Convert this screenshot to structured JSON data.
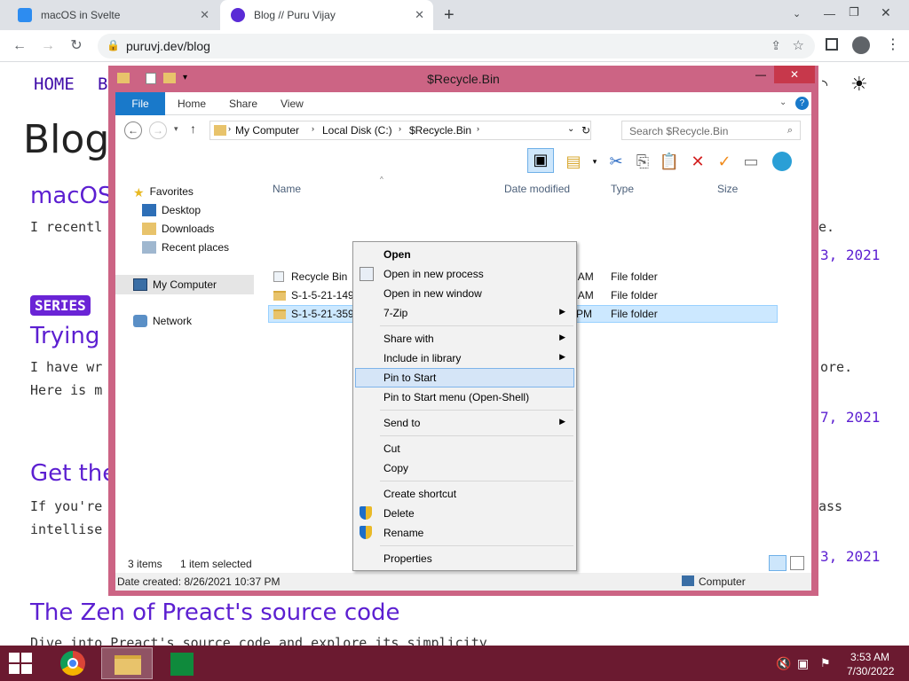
{
  "browser": {
    "tabs": [
      {
        "label": "macOS in Svelte"
      },
      {
        "label": "Blog // Puru Vijay"
      }
    ],
    "new_tab": "+",
    "url": "puruvj.dev/blog"
  },
  "blog": {
    "nav": {
      "home": "HOME",
      "blog": "B"
    },
    "title": "Blog",
    "posts": [
      {
        "title": "macOS",
        "excerpt": "I recentl",
        "excerpt_end": "e.",
        "date": "3, 2021"
      },
      {
        "series": "SERIES",
        "title": "Trying",
        "excerpt1": "I have wr",
        "excerpt1_end": "ore.",
        "excerpt2": "Here is m",
        "date": "7, 2021"
      },
      {
        "title": "Get the",
        "excerpt1": "If you're",
        "excerpt1_end": "ass",
        "excerpt2": "intellise",
        "date": "3, 2021"
      },
      {
        "title": "The Zen of Preact's source code",
        "excerpt": "Dive into Preact's source code and explore its simplicity"
      }
    ]
  },
  "explorer": {
    "title": "$Recycle.Bin",
    "ribbon_tabs": [
      "File",
      "Home",
      "Share",
      "View"
    ],
    "path": [
      "My Computer",
      "Local Disk (C:)",
      "$Recycle.Bin"
    ],
    "search_placeholder": "Search $Recycle.Bin",
    "nav": {
      "favorites": "Favorites",
      "desktop": "Desktop",
      "downloads": "Downloads",
      "recent": "Recent places",
      "computer": "My Computer",
      "network": "Network"
    },
    "columns": {
      "name": "Name",
      "date": "Date modified",
      "type": "Type",
      "size": "Size"
    },
    "rows": [
      {
        "name": "Recycle Bin",
        "date": "7/30/2022 2:50 AM",
        "type": "File folder"
      },
      {
        "name": "S-1-5-21-1491751080-2360097156-170421...",
        "date": "8/26/2021 9:05 AM",
        "type": "File folder"
      },
      {
        "name": "S-1-5-21-359",
        "date": "PM",
        "type": "File folder"
      }
    ],
    "status": {
      "items": "3 items",
      "selected": "1 item selected"
    },
    "details": {
      "created": "Date created: 8/26/2021 10:37 PM",
      "location": "Computer"
    }
  },
  "context_menu": {
    "items": [
      {
        "label": "Open"
      },
      {
        "label": "Open in new process"
      },
      {
        "label": "Open in new window"
      },
      {
        "label": "7-Zip"
      },
      {
        "label": "Share with"
      },
      {
        "label": "Include in library"
      },
      {
        "label": "Pin to Start"
      },
      {
        "label": "Pin to Start menu (Open-Shell)"
      },
      {
        "label": "Send to"
      },
      {
        "label": "Cut"
      },
      {
        "label": "Copy"
      },
      {
        "label": "Create shortcut"
      },
      {
        "label": "Delete"
      },
      {
        "label": "Rename"
      },
      {
        "label": "Properties"
      }
    ]
  },
  "taskbar": {
    "time": "3:53 AM",
    "date": "7/30/2022"
  },
  "colors": {
    "window_frame": "#cc6484",
    "taskbar": "#6b1a30",
    "blog_accent": "#5c1fd1",
    "ribbon_file": "#1979ca",
    "selection": "#cce8ff"
  }
}
